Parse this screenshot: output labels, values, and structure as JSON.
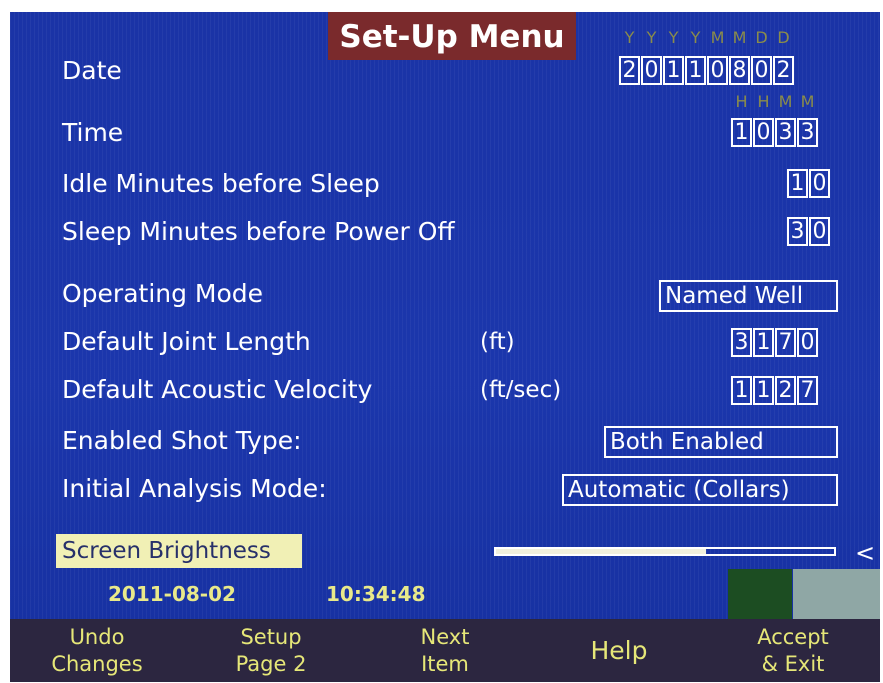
{
  "title": "Set-Up Menu",
  "date": {
    "label": "Date",
    "header": [
      "Y",
      "Y",
      "Y",
      "Y",
      "M",
      "M",
      "D",
      "D"
    ],
    "digits": [
      "2",
      "0",
      "1",
      "1",
      "0",
      "8",
      "0",
      "2"
    ]
  },
  "time": {
    "label": "Time",
    "header": [
      "H",
      "H",
      "M",
      "M"
    ],
    "digits": [
      "1",
      "0",
      "3",
      "3"
    ]
  },
  "idle": {
    "label": "Idle Minutes before Sleep",
    "digits": [
      "1",
      "0"
    ]
  },
  "sleep": {
    "label": "Sleep Minutes before Power Off",
    "digits": [
      "3",
      "0"
    ]
  },
  "operating_mode": {
    "label": "Operating Mode",
    "value": "Named Well"
  },
  "joint_length": {
    "label": "Default Joint Length",
    "unit": "(ft)",
    "digits": [
      "3",
      "1",
      "7",
      "0"
    ]
  },
  "acoustic_velocity": {
    "label": "Default Acoustic Velocity",
    "unit": "(ft/sec)",
    "digits": [
      "1",
      "1",
      "2",
      "7"
    ]
  },
  "shot_type": {
    "label": "Enabled Shot Type:",
    "value": "Both Enabled"
  },
  "analysis_mode": {
    "label": "Initial Analysis Mode:",
    "value": "Automatic (Collars)"
  },
  "brightness": {
    "label": "Screen Brightness",
    "level": 0.62,
    "arrow": "<"
  },
  "status": {
    "date": "2011-08-02",
    "time": "10:34:48"
  },
  "fkeys": [
    {
      "line1": "Undo",
      "line2": "Changes"
    },
    {
      "line1": "Setup",
      "line2": "Page 2"
    },
    {
      "line1": "Next",
      "line2": "Item"
    },
    {
      "line1": "Help",
      "line2": ""
    },
    {
      "line1": "Accept",
      "line2": "& Exit"
    }
  ],
  "colors": {
    "background": "#1a33a6",
    "title_bg": "#7a2a2c",
    "highlight": "#f1f0b5",
    "softkey_text": "#e6e778"
  }
}
